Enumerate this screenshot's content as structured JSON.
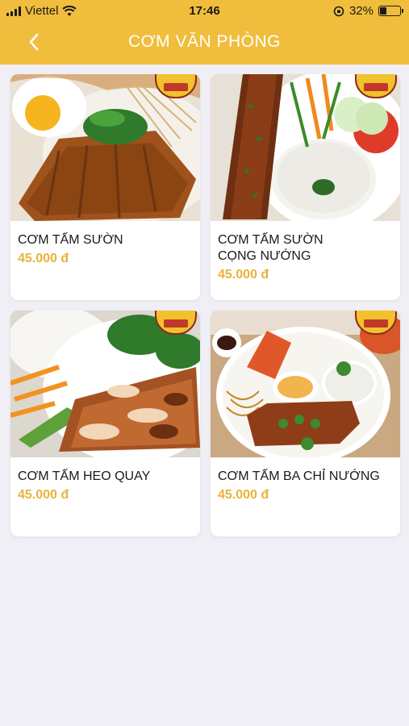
{
  "status": {
    "carrier": "Viettel",
    "time": "17:46",
    "battery_text": "32%",
    "battery_level": 0.32
  },
  "header": {
    "title": "CƠM VĂN PHÒNG",
    "back_icon": "chevron-left-icon"
  },
  "colors": {
    "header_bg": "#f1bd3c",
    "price": "#e8b337",
    "page_bg": "#f0eff5"
  },
  "products": [
    {
      "name": "CƠM TẤM SƯỜN",
      "price": "45.000 đ"
    },
    {
      "name": "CƠM TẤM SƯỜN CỌNG NƯỚNG",
      "price": "45.000 đ"
    },
    {
      "name": "CƠM TẤM HEO QUAY",
      "price": "45.000 đ"
    },
    {
      "name": "CƠM TẤM BA CHỈ NƯỚNG",
      "price": "45.000 đ"
    }
  ]
}
